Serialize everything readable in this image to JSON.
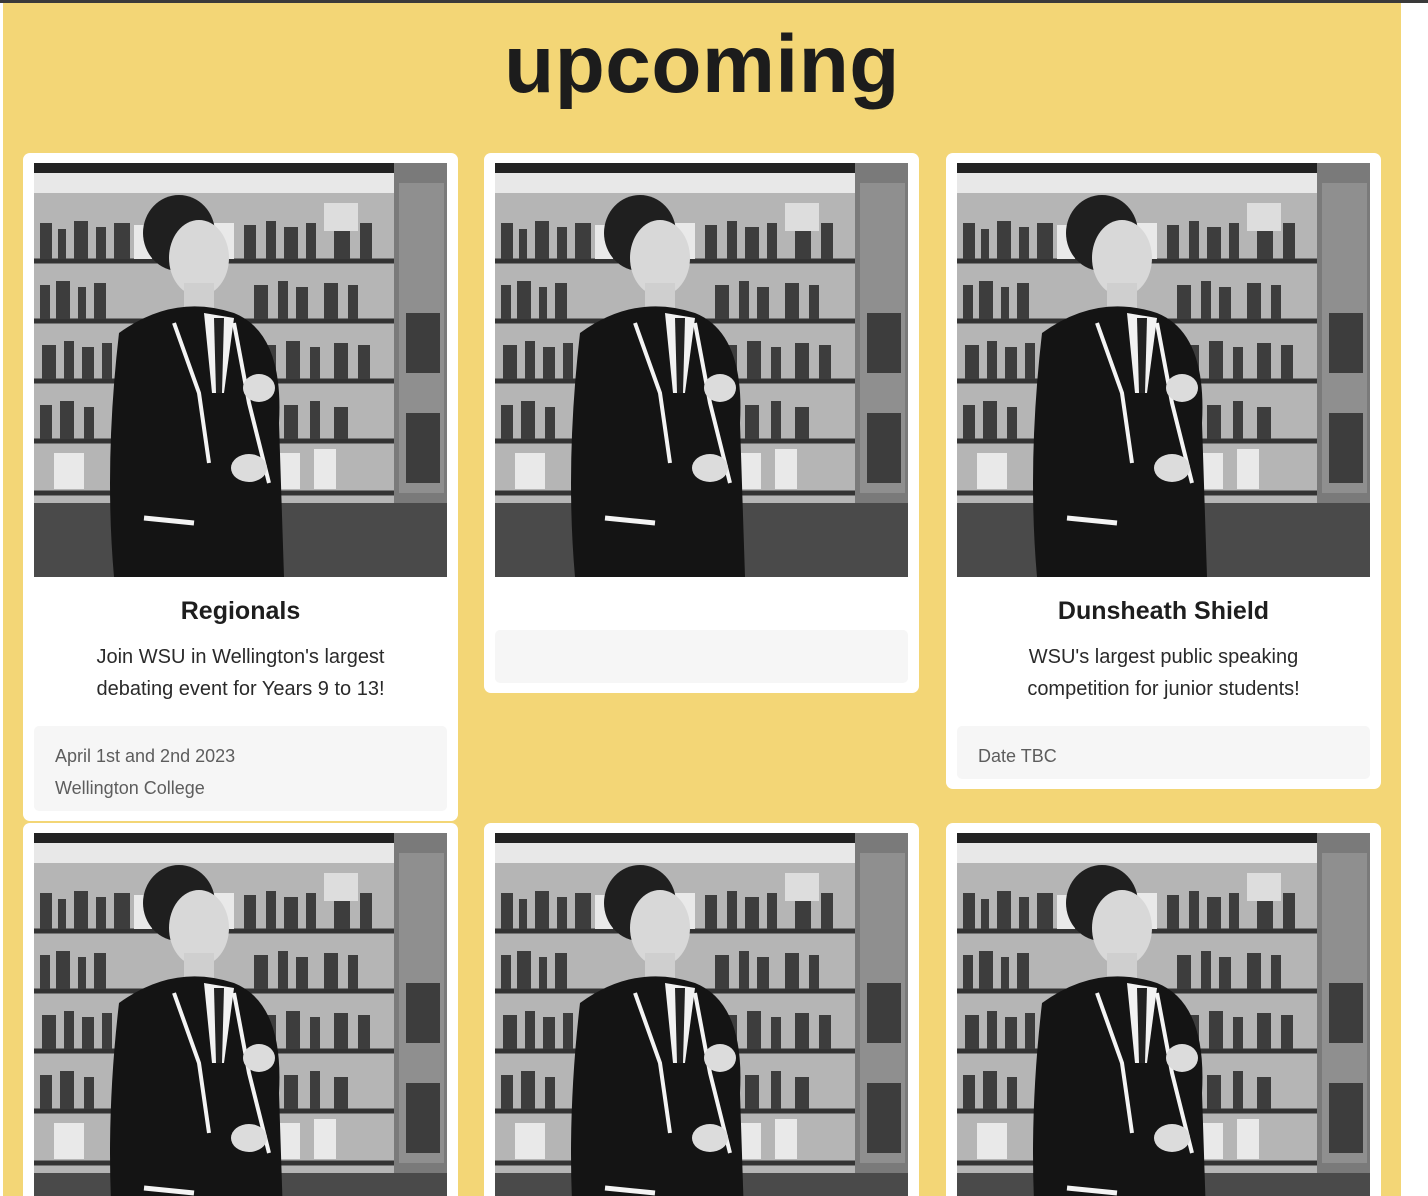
{
  "page": {
    "heading": "upcoming"
  },
  "cards": [
    {
      "title": "Regionals",
      "description": "Join WSU in Wellington's largest debating event for Years 9 to 13!",
      "footer_date": "April 1st and 2nd 2023",
      "footer_location": "Wellington College",
      "image_alt": "Student speaking in a library"
    },
    {
      "title": "",
      "description": "",
      "footer_date": "",
      "footer_location": "",
      "image_alt": "Student speaking in a library"
    },
    {
      "title": "Dunsheath Shield",
      "description": "WSU's largest public speaking competition for junior students!",
      "footer_date": "Date TBC",
      "footer_location": "",
      "image_alt": "Student speaking in a library"
    },
    {
      "image_alt": "Student speaking in a library"
    },
    {
      "image_alt": "Student speaking in a library"
    },
    {
      "image_alt": "Student speaking in a library"
    }
  ],
  "colors": {
    "page_background": "#f3d676",
    "card_background": "#ffffff",
    "footer_background": "#f6f6f6",
    "heading_text": "#1c1c1c"
  }
}
